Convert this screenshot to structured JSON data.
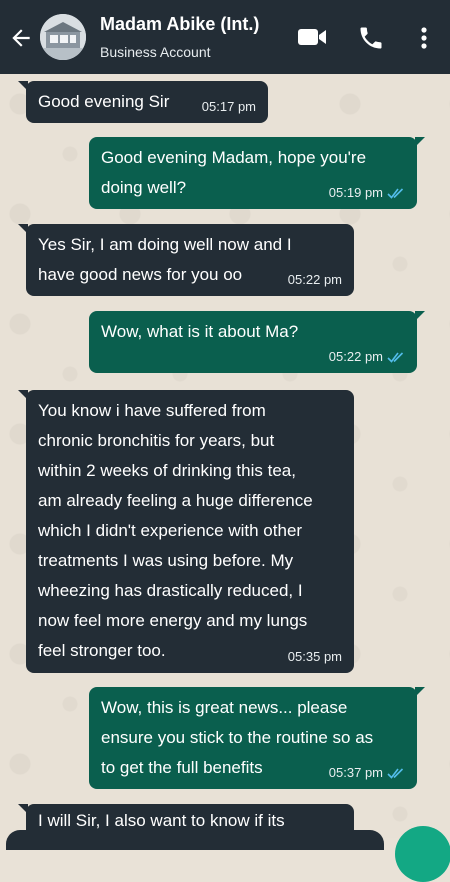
{
  "header": {
    "contact_name": "Madam Abike (Int.)",
    "subtitle": "Business Account",
    "icons": [
      "back-arrow-icon",
      "video-call-icon",
      "voice-call-icon",
      "menu-dots-icon"
    ]
  },
  "colors": {
    "header_bg": "#232d36",
    "incoming_bubble": "#232d36",
    "outgoing_bubble": "#0a5f4e",
    "read_ticks": "#53bdeb",
    "chat_bg": "#e8e1d6"
  },
  "messages": [
    {
      "direction": "in",
      "text": "Good evening Sir",
      "time": "05:17 pm"
    },
    {
      "direction": "out",
      "text": "Good evening Madam, hope you're\ndoing well?",
      "time": "05:19 pm",
      "status": "read"
    },
    {
      "direction": "in",
      "text": "Yes Sir, I am doing well now and I\nhave good news for you oo",
      "time": "05:22 pm"
    },
    {
      "direction": "out",
      "text": "Wow, what is it about Ma?",
      "time": "05:22 pm",
      "status": "read"
    },
    {
      "direction": "in",
      "text": "You know i have suffered from\nchronic bronchitis for years, but\nwithin 2 weeks of drinking this tea,\nam already feeling a huge difference\nwhich I didn't experience with other\ntreatments I was using before. My\nwheezing has drastically reduced, I\nnow feel more energy and my lungs\nfeel stronger too.",
      "time": "05:35 pm"
    },
    {
      "direction": "out",
      "text": "Wow, this is great news... please\nensure you stick to the routine so as\nto get the full benefits",
      "time": "05:37 pm",
      "status": "read"
    },
    {
      "direction": "in",
      "text": "I will Sir, I also want to know if its",
      "time": ""
    }
  ]
}
